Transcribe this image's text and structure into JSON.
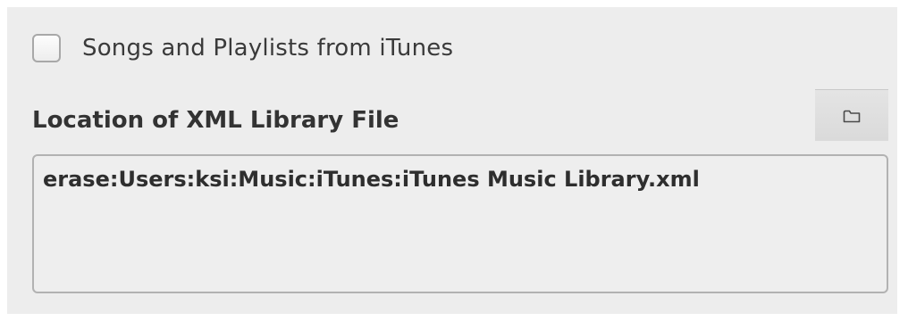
{
  "itunes_option": {
    "checked": false,
    "label": "Songs and Playlists from iTunes"
  },
  "xml_library": {
    "heading": "Location of XML Library File",
    "path": "erase:Users:ksi:Music:iTunes:iTunes Music Library.xml",
    "browse_icon": "folder-icon"
  }
}
